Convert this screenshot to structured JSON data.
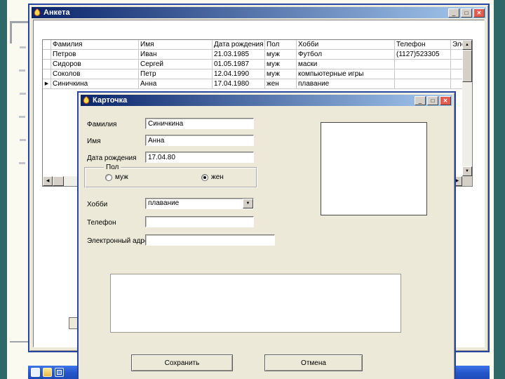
{
  "icons": {
    "row_indicator": "▶",
    "scroll_up": "▲",
    "scroll_down": "▼",
    "scroll_left": "◀",
    "scroll_right": "▶",
    "combo_arrow": "▼",
    "minimize": "_",
    "maximize": "□",
    "close": "✕"
  },
  "colors": {
    "titlebar_left": "#0A246A",
    "titlebar_right": "#A6CAF0",
    "dialog_face": "#ECE9D8",
    "taskbar_blue": "#2456C9",
    "slide_accent_teal": "#2E6868",
    "close_button_red": "#E25B4D"
  },
  "main_window": {
    "title": "Анкета",
    "grid": {
      "columns": [
        "Фамилия",
        "Имя",
        "Дата рождения",
        "Пол",
        "Хобби",
        "Телефон",
        "Элект"
      ],
      "rows": [
        {
          "surname": "Петров",
          "name": "Иван",
          "birthdate": "21.03.1985",
          "gender": "муж",
          "hobby": "Футбол",
          "phone": "(1127)523305",
          "email": ""
        },
        {
          "surname": "Сидоров",
          "name": "Сергей",
          "birthdate": "01.05.1987",
          "gender": "муж",
          "hobby": "маски",
          "phone": "",
          "email": ""
        },
        {
          "surname": "Соколов",
          "name": "Петр",
          "birthdate": "12.04.1990",
          "gender": "муж",
          "hobby": "компьютерные игры",
          "phone": "",
          "email": ""
        },
        {
          "surname": "Синичкина",
          "name": "Анна",
          "birthdate": "17.04.1980",
          "gender": "жен",
          "hobby": "плавание",
          "phone": "",
          "email": ""
        }
      ],
      "current_row_index": 3
    }
  },
  "dialog": {
    "title": "Карточка",
    "surname_label": "Фамилия",
    "surname_value": "Синичкина",
    "name_label": "Имя",
    "name_value": "Анна",
    "birthdate_label": "Дата рождения",
    "birthdate_value": "17.04.80",
    "gender_group_label": "Пол",
    "gender_male_label": "муж",
    "gender_female_label": "жен",
    "gender_selected": "жен",
    "hobby_label": "Хобби",
    "hobby_value": "плавание",
    "phone_label": "Телефон",
    "phone_value": "",
    "email_label": "Электронный адрес",
    "email_value": "",
    "save_button": "Сохранить",
    "cancel_button": "Отмена"
  },
  "taskbar": {
    "icon_names": [
      "quick-launch-icon-1",
      "quick-launch-icon-2",
      "show-desktop-icon"
    ]
  }
}
